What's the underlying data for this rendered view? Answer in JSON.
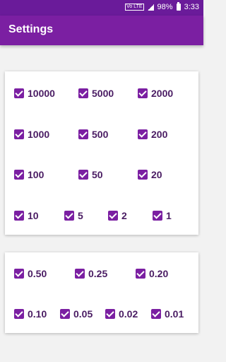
{
  "status": {
    "volte": "Vo LTE",
    "battery": "98%",
    "time": "3:33"
  },
  "appbar": {
    "title": "Settings"
  },
  "notes": [
    {
      "label": "10000",
      "checked": true
    },
    {
      "label": "5000",
      "checked": true
    },
    {
      "label": "2000",
      "checked": true
    },
    {
      "label": "1000",
      "checked": true
    },
    {
      "label": "500",
      "checked": true
    },
    {
      "label": "200",
      "checked": true
    },
    {
      "label": "100",
      "checked": true
    },
    {
      "label": "50",
      "checked": true
    },
    {
      "label": "20",
      "checked": true
    },
    {
      "label": "10",
      "checked": true
    },
    {
      "label": "5",
      "checked": true
    },
    {
      "label": "2",
      "checked": true
    },
    {
      "label": "1",
      "checked": true
    }
  ],
  "coins": [
    {
      "label": "0.50",
      "checked": true
    },
    {
      "label": "0.25",
      "checked": true
    },
    {
      "label": "0.20",
      "checked": true
    },
    {
      "label": "0.10",
      "checked": true
    },
    {
      "label": "0.05",
      "checked": true
    },
    {
      "label": "0.02",
      "checked": true
    },
    {
      "label": "0.01",
      "checked": true
    }
  ],
  "colors": {
    "primary": "#7b1fa2",
    "status_bar": "#6a1b9a"
  }
}
